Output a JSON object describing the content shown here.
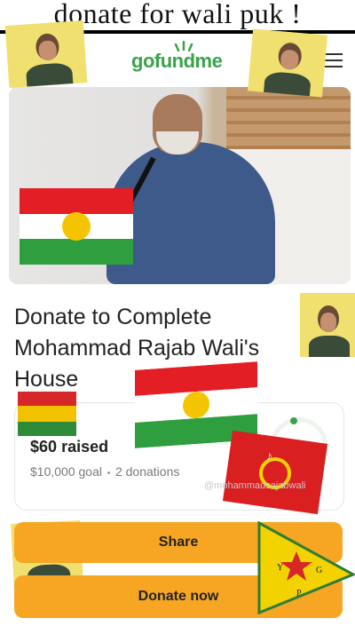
{
  "caption": "donate for wali puk !",
  "header": {
    "logo_text": "gofundme",
    "menu_icon": "hamburger-menu-icon"
  },
  "campaign": {
    "title": "Donate to Complete Mohammad Rajab Wali's House",
    "raised_amount": "$60",
    "raised_label": "raised",
    "goal": "$10,000 goal",
    "donations": "2 donations",
    "progress_fraction": 0.006
  },
  "buttons": {
    "share_label": "Share",
    "donate_label": "Donate now"
  },
  "overlay": {
    "tiktok_handle": "@mohammadsajabwali",
    "tiktok_logo": "tiktok-logo-icon",
    "ypg_letters": [
      "Y",
      "P",
      "G"
    ]
  },
  "colors": {
    "brand_green": "#3aa34a",
    "button_orange": "#f6a623",
    "kurdish_red": "#e31e24",
    "kurdish_green": "#2f9e3e",
    "kurdish_sun": "#f5c400"
  }
}
